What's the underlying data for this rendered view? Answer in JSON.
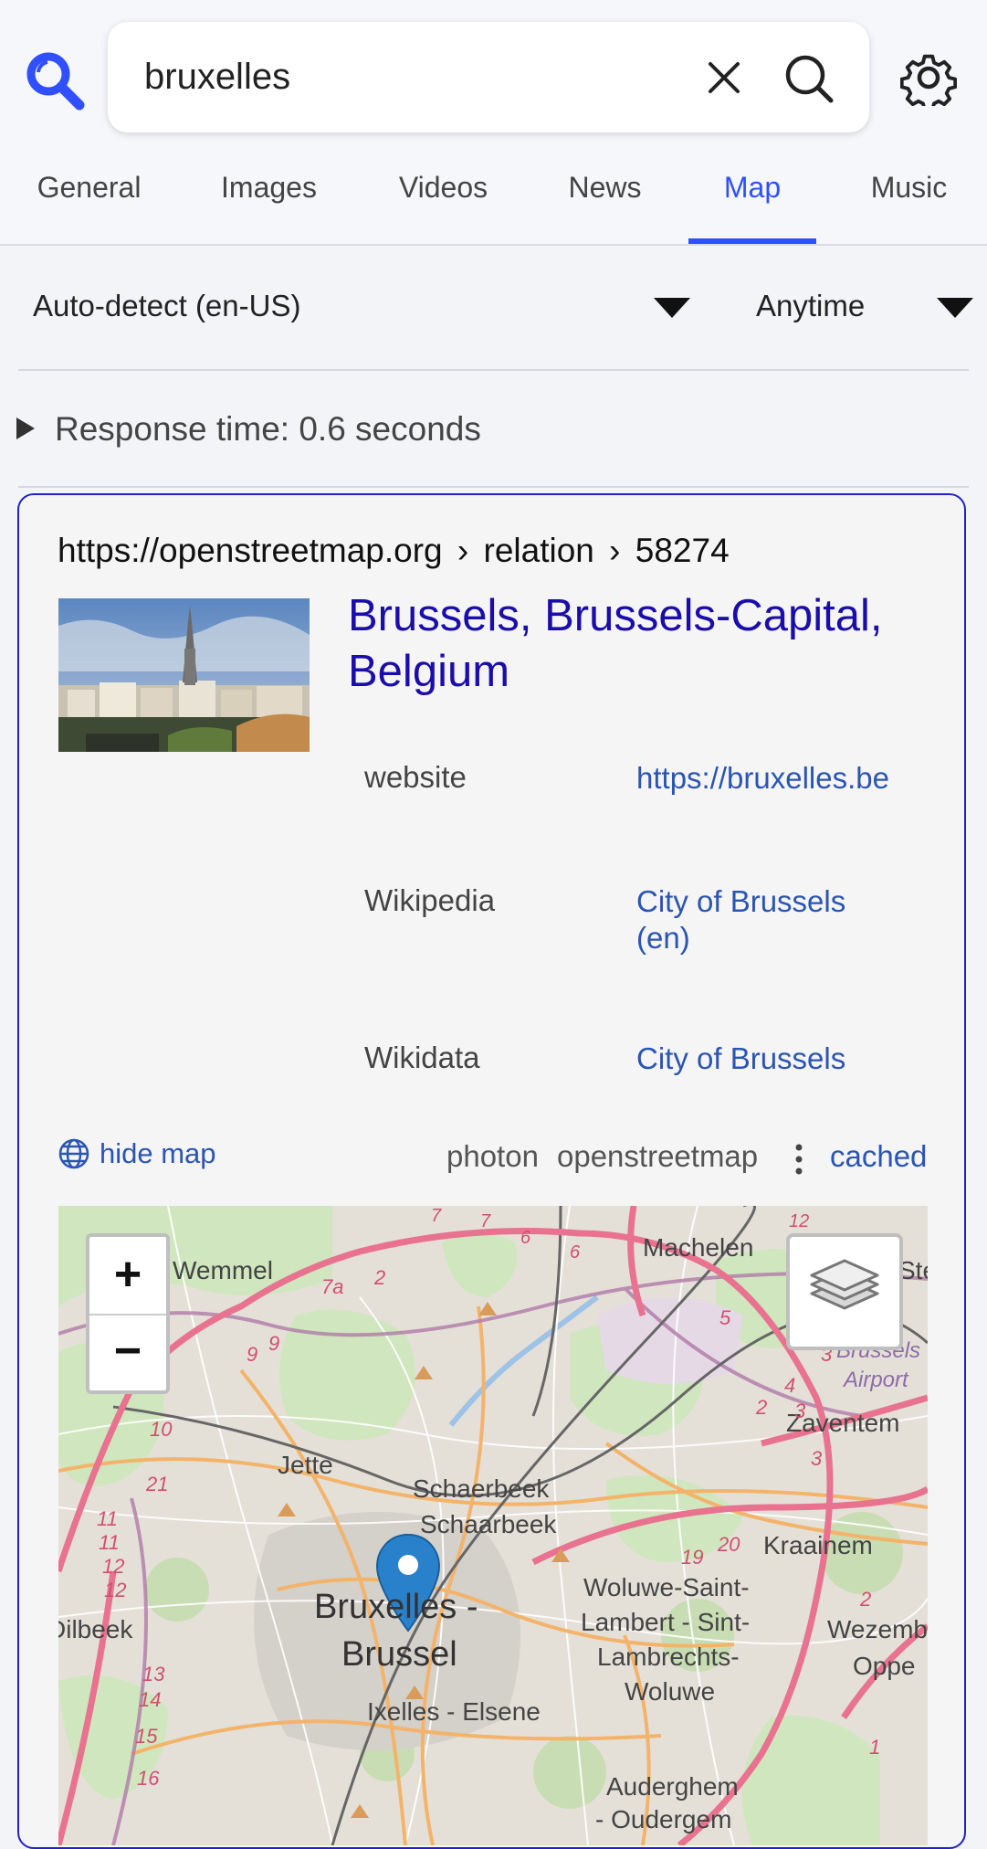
{
  "search": {
    "query": "bruxelles"
  },
  "tabs": [
    {
      "label": "General"
    },
    {
      "label": "Images"
    },
    {
      "label": "Videos"
    },
    {
      "label": "News"
    },
    {
      "label": "Map"
    },
    {
      "label": "Music"
    }
  ],
  "active_tab": "Map",
  "filters": {
    "language": "Auto-detect (en-US)",
    "time": "Anytime"
  },
  "response_time": "Response time: 0.6 seconds",
  "result": {
    "url": {
      "host": "https://openstreetmap.org",
      "path1": "relation",
      "path2": "58274",
      "separator": "›"
    },
    "title": "Brussels, Brussels-Capital, Belgium",
    "details": [
      {
        "key": "website",
        "value": "https://bruxelles.be"
      },
      {
        "key": "Wikipedia",
        "value": "City of Brussels (en)"
      },
      {
        "key": "Wikidata",
        "value": "City of Brussels"
      }
    ],
    "hide_map": "hide map",
    "engines": [
      "photon",
      "openstreetmap"
    ],
    "cached": "cached"
  },
  "map": {
    "zoom_in": "+",
    "zoom_out": "−",
    "labels": {
      "wemmel": "Wemmel",
      "machelen": "Machelen",
      "ste": "Ste",
      "brussels_airport_1": "Brussels",
      "brussels_airport_2": "Airport",
      "zaventem": "Zaventem",
      "jette": "Jette",
      "schaerbeek1": "Schaerbeek",
      "schaerbeek2": "Schaarbeek",
      "kraainem": "Kraainem",
      "bruxelles1": "Bruxelles -",
      "bruxelles2": "Brussel",
      "woluwe1": "Woluwe-Saint-",
      "woluwe2": "Lambert - Sint-",
      "woluwe3": "Lambrechts-",
      "woluwe4": "Woluwe",
      "dilbeek": "Dilbeek",
      "wezemb": "Wezemb",
      "oppe": "Oppe",
      "ixelles": "Ixelles - Elsene",
      "auderghem1": "Auderghem",
      "auderghem2": "- Oudergem"
    },
    "road_numbers": [
      "7",
      "7",
      "6",
      "6",
      "12",
      "2",
      "7a",
      "9",
      "9",
      "5",
      "3",
      "4",
      "2",
      "3",
      "3",
      "10",
      "21",
      "11",
      "11",
      "12",
      "12",
      "19",
      "20",
      "2",
      "13",
      "14",
      "15",
      "16",
      "1"
    ]
  },
  "colors": {
    "accent": "#3050ff",
    "link": "#1a0dab",
    "card_border": "#2321c6"
  }
}
